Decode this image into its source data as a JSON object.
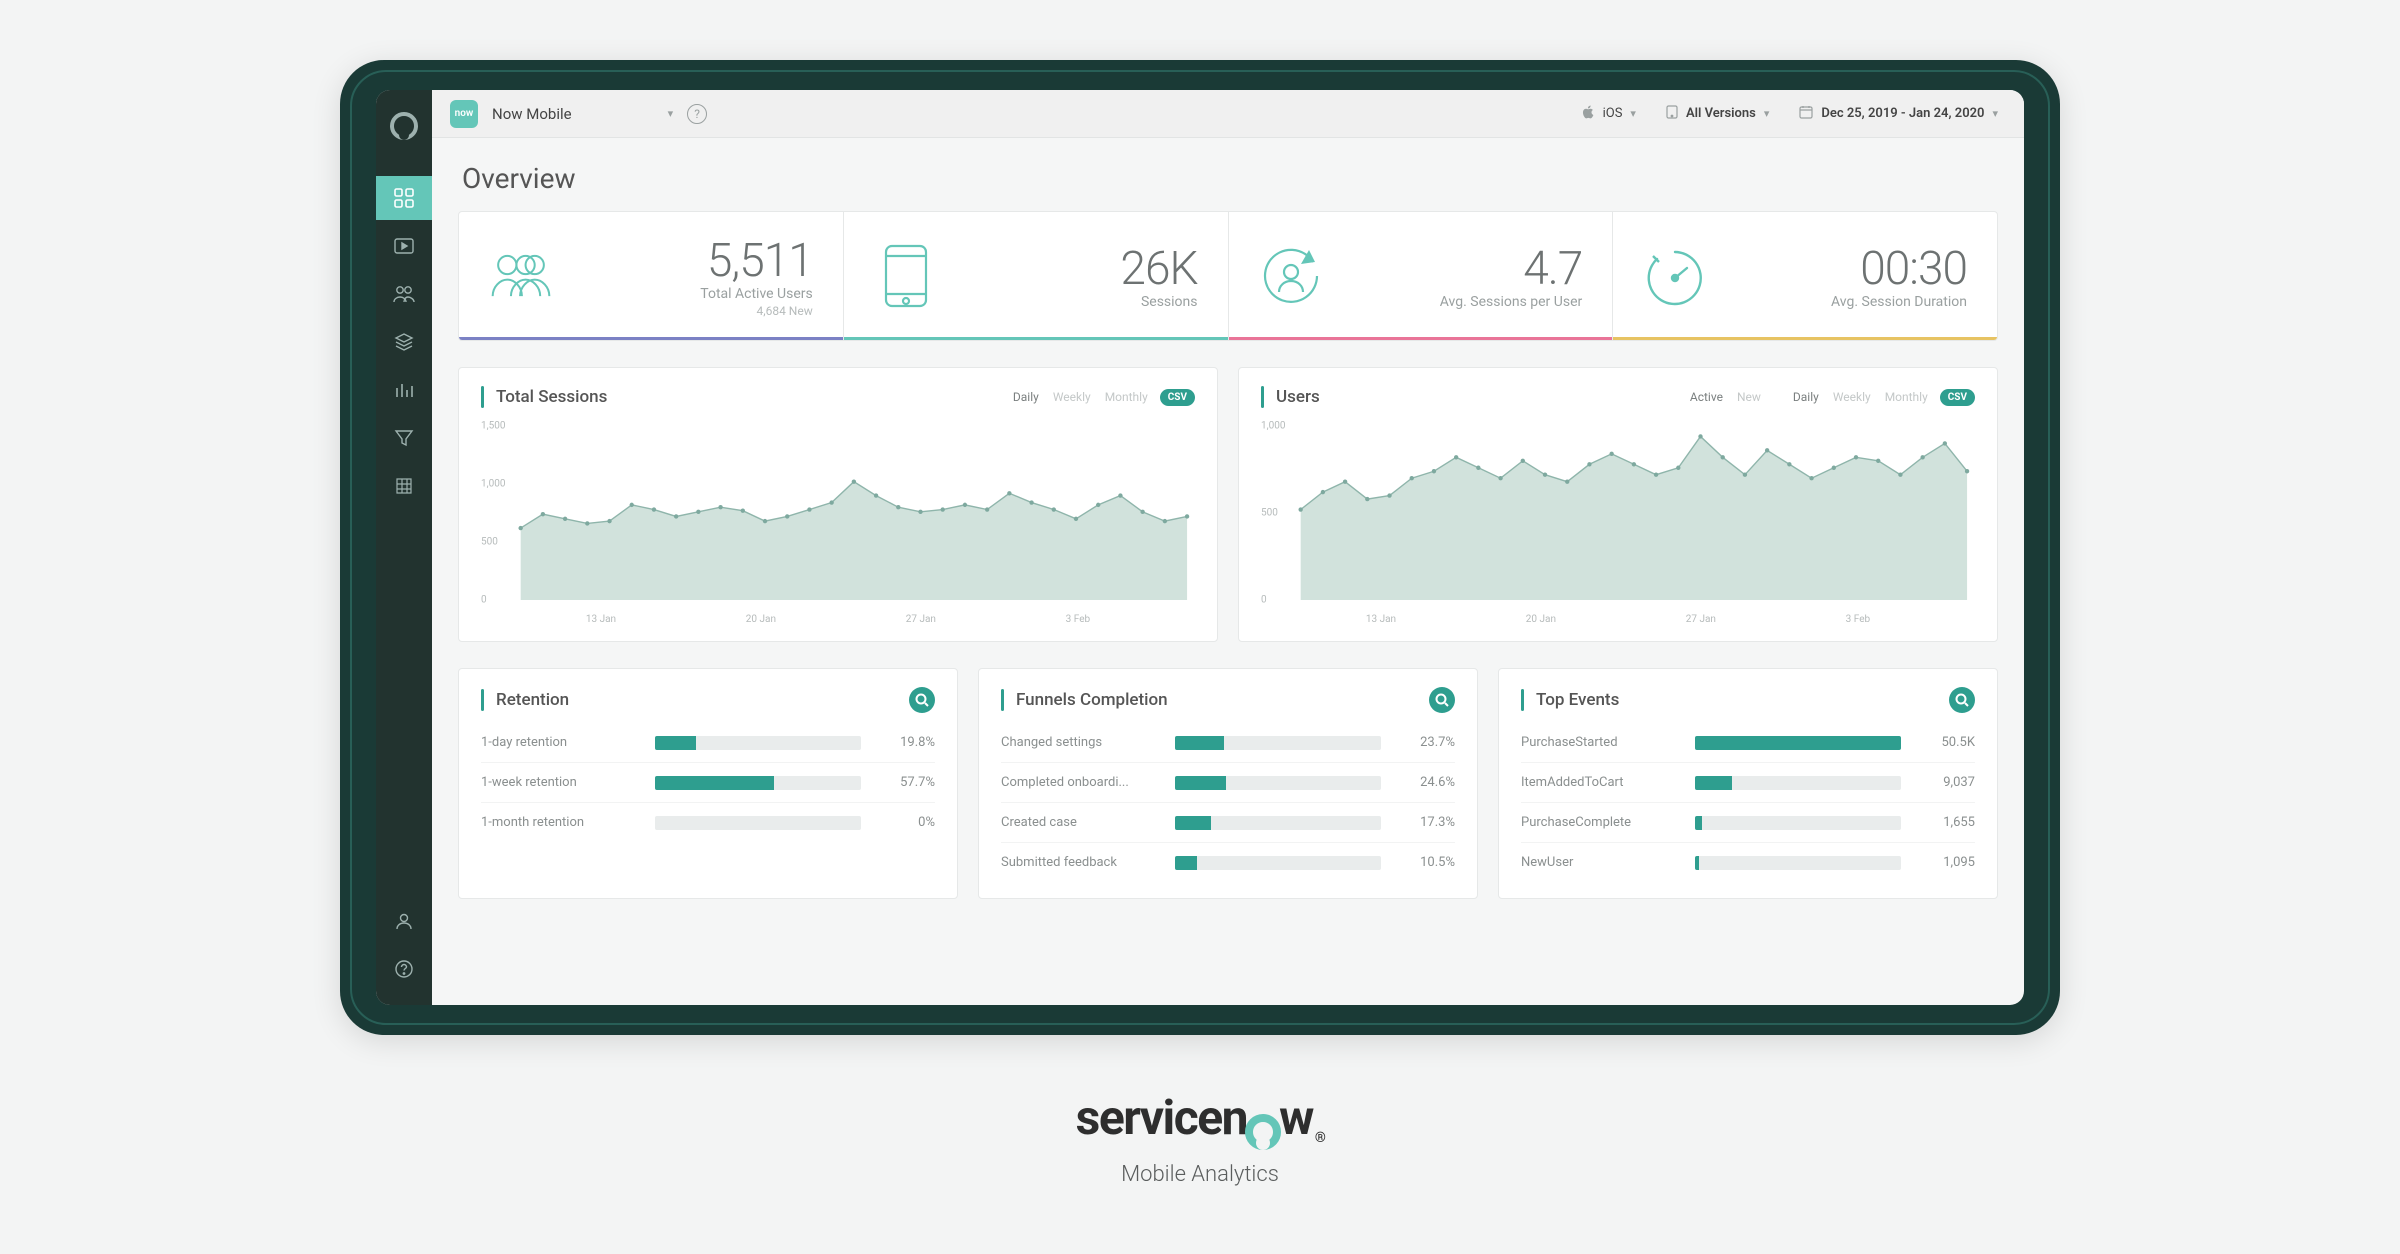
{
  "header": {
    "app_name": "Now Mobile",
    "app_badge": "now",
    "platform": "iOS",
    "version": "All Versions",
    "date_range": "Dec 25, 2019 - Jan 24, 2020"
  },
  "page": {
    "title": "Overview"
  },
  "kpi": [
    {
      "value": "5,511",
      "label": "Total Active Users",
      "sub": "4,684 New",
      "color": "#7b81c4"
    },
    {
      "value": "26K",
      "label": "Sessions",
      "sub": "",
      "color": "#64c6b8"
    },
    {
      "value": "4.7",
      "label": "Avg. Sessions per User",
      "sub": "",
      "color": "#e97498"
    },
    {
      "value": "00:30",
      "label": "Avg. Session Duration",
      "sub": "",
      "color": "#e7c362"
    }
  ],
  "sessions_card": {
    "title": "Total Sessions",
    "ranges": [
      "Daily",
      "Weekly",
      "Monthly"
    ],
    "selected": "Daily",
    "csv": "CSV"
  },
  "users_card": {
    "title": "Users",
    "types": [
      "Active",
      "New"
    ],
    "type_selected": "Active",
    "ranges": [
      "Daily",
      "Weekly",
      "Monthly"
    ],
    "selected": "Daily",
    "csv": "CSV"
  },
  "chart_data": [
    {
      "type": "area",
      "title": "Total Sessions",
      "ylim": [
        0,
        1500
      ],
      "yticks": [
        0,
        500,
        1000,
        1500
      ],
      "xticks": [
        "13 Jan",
        "20 Jan",
        "27 Jan",
        "3 Feb"
      ],
      "values": [
        620,
        740,
        700,
        660,
        680,
        820,
        780,
        720,
        760,
        800,
        770,
        680,
        720,
        780,
        840,
        1020,
        900,
        800,
        760,
        780,
        820,
        780,
        920,
        840,
        780,
        700,
        820,
        900,
        760,
        680,
        720
      ]
    },
    {
      "type": "area",
      "title": "Users",
      "ylim": [
        0,
        1000
      ],
      "yticks": [
        0,
        500,
        1000
      ],
      "xticks": [
        "13 Jan",
        "20 Jan",
        "27 Jan",
        "3 Feb"
      ],
      "values": [
        520,
        620,
        680,
        580,
        600,
        700,
        740,
        820,
        760,
        700,
        800,
        720,
        680,
        780,
        840,
        780,
        720,
        760,
        940,
        820,
        720,
        860,
        780,
        700,
        760,
        820,
        800,
        720,
        820,
        900,
        740
      ]
    }
  ],
  "retention": {
    "title": "Retention",
    "rows": [
      {
        "name": "1-day retention",
        "value": "19.8%",
        "pct": 19.8
      },
      {
        "name": "1-week retention",
        "value": "57.7%",
        "pct": 57.7
      },
      {
        "name": "1-month retention",
        "value": "0%",
        "pct": 0
      }
    ]
  },
  "funnels": {
    "title": "Funnels Completion",
    "rows": [
      {
        "name": "Changed settings",
        "value": "23.7%",
        "pct": 23.7
      },
      {
        "name": "Completed onboardi...",
        "value": "24.6%",
        "pct": 24.6
      },
      {
        "name": "Created case",
        "value": "17.3%",
        "pct": 17.3
      },
      {
        "name": "Submitted feedback",
        "value": "10.5%",
        "pct": 10.5
      }
    ]
  },
  "events": {
    "title": "Top Events",
    "max": 50500,
    "rows": [
      {
        "name": "PurchaseStarted",
        "value": "50.5K",
        "raw": 50500
      },
      {
        "name": "ItemAddedToCart",
        "value": "9,037",
        "raw": 9037
      },
      {
        "name": "PurchaseComplete",
        "value": "1,655",
        "raw": 1655
      },
      {
        "name": "NewUser",
        "value": "1,095",
        "raw": 1095
      }
    ]
  },
  "footer": {
    "brand_pre": "servicen",
    "brand_post": "w",
    "subtitle": "Mobile Analytics"
  }
}
